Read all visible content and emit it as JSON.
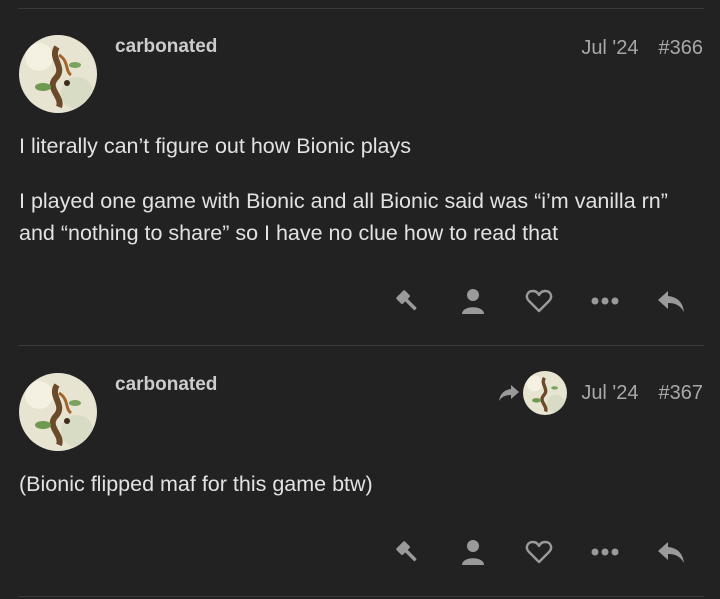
{
  "posts": [
    {
      "username": "carbonated",
      "date": "Jul '24",
      "number": "#366",
      "paragraphs": [
        "I literally can’t figure out how Bionic plays",
        "I played one game with Bionic and all Bionic said was “i’m vanilla rn” and “nothing to share” so I have no clue how to read that"
      ]
    },
    {
      "username": "carbonated",
      "date": "Jul '24",
      "number": "#367",
      "paragraphs": [
        "(Bionic flipped maf for this game btw)"
      ]
    }
  ],
  "colors": {
    "background": "#222222",
    "text": "#e2e2e2",
    "muted": "#a8a8a8",
    "icon": "#9a9a9a",
    "divider": "#3a3a3a"
  },
  "icons": {
    "actions": [
      "gavel-icon",
      "user-icon",
      "heart-icon",
      "ellipsis-icon",
      "reply-icon"
    ],
    "reply_to": "share-arrow-icon"
  }
}
